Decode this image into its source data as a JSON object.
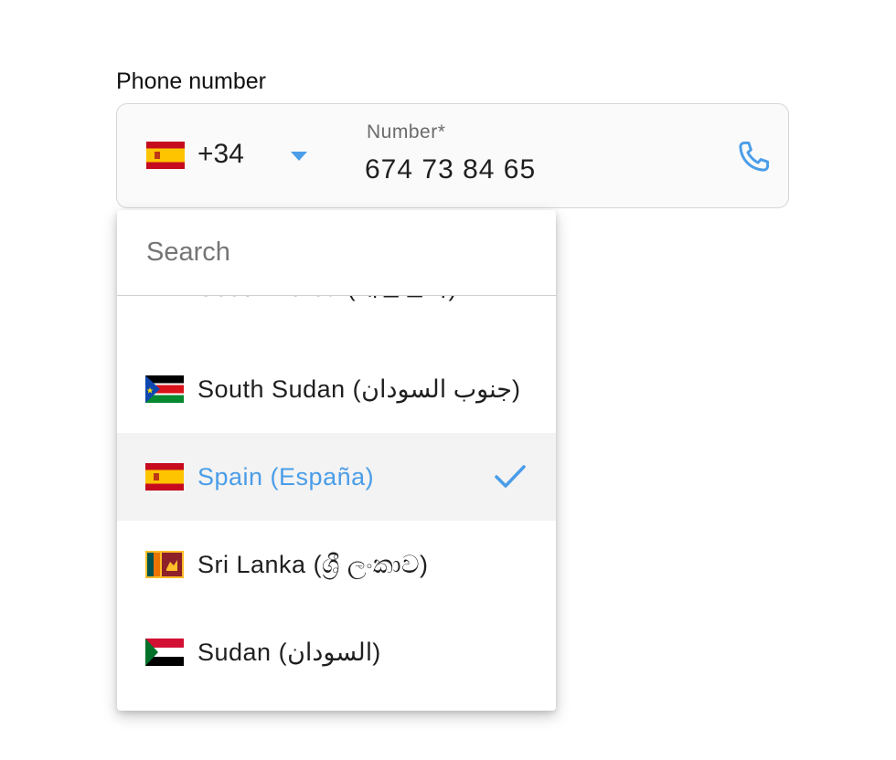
{
  "field": {
    "label": "Phone number",
    "number_label": "Number*",
    "number_value": "674 73 84 65"
  },
  "country_select": {
    "dial_code": "+34",
    "selected_country": "Spain"
  },
  "dropdown": {
    "search_placeholder": "Search",
    "items": [
      {
        "label": "South Korea (대한민국)",
        "flag": "kr"
      },
      {
        "label": "South Sudan (جنوب السودان)",
        "flag": "ss"
      },
      {
        "label": "Spain (España)",
        "flag": "es",
        "selected": true
      },
      {
        "label": "Sri Lanka (ශ්‍රී ලංකාව)",
        "flag": "lk"
      },
      {
        "label": "Sudan (السودان)",
        "flag": "sd"
      }
    ]
  },
  "colors": {
    "accent": "#4a9de8",
    "selected_bg": "#f3f3f3",
    "border": "#d6d6d6",
    "text": "#1f1f1f",
    "muted": "#6b6b6b"
  },
  "icons": {
    "phone": "phone-icon",
    "caret": "triangle-down-icon",
    "check": "checkmark-icon"
  }
}
